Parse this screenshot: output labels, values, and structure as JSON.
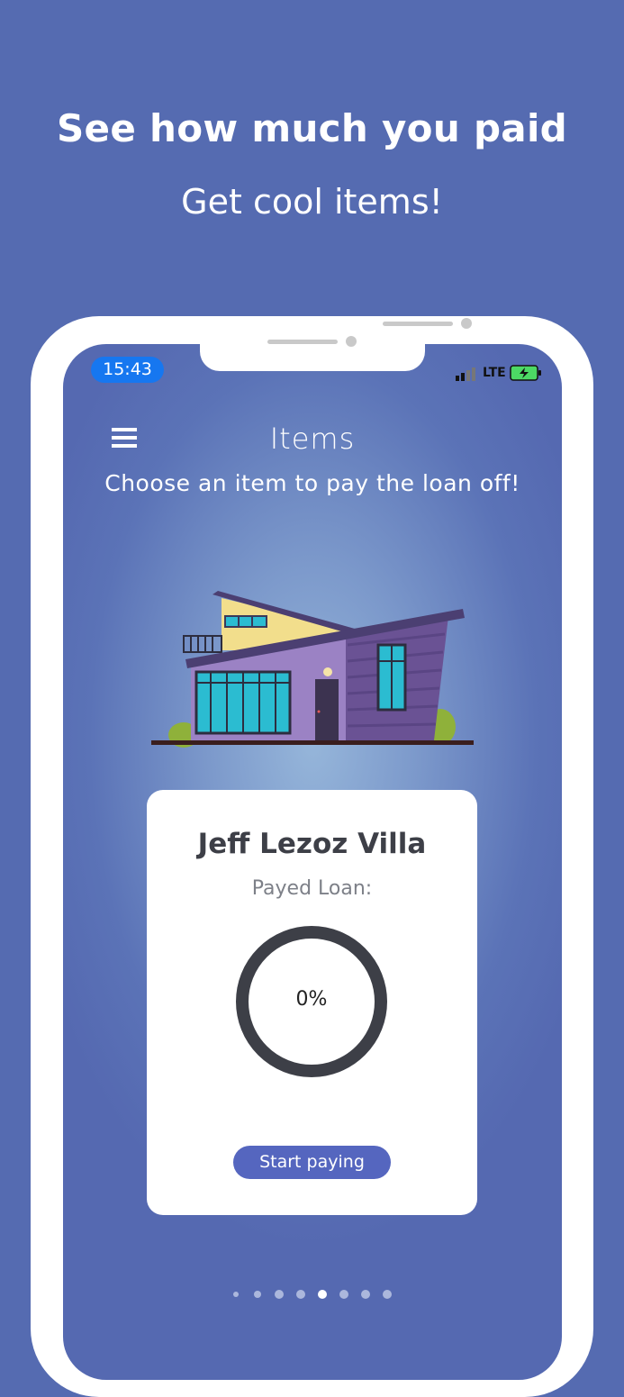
{
  "promo": {
    "headline": "See how much you paid",
    "subline": "Get cool items!"
  },
  "status_bar": {
    "time": "15:43",
    "network": "LTE"
  },
  "header": {
    "title": "Items",
    "instruction": "Choose an item to pay the loan off!"
  },
  "item_card": {
    "name": "Jeff Lezoz Villa",
    "progress_label": "Payed Loan:",
    "progress_value": "0%",
    "progress_fraction": 0,
    "button_label": "Start paying"
  },
  "pager": {
    "count": 8,
    "active_index": 4
  },
  "colors": {
    "background": "#556bb1",
    "accent_button": "#5566bf",
    "time_pill": "#1677f0",
    "ring": "#3d3f47"
  }
}
